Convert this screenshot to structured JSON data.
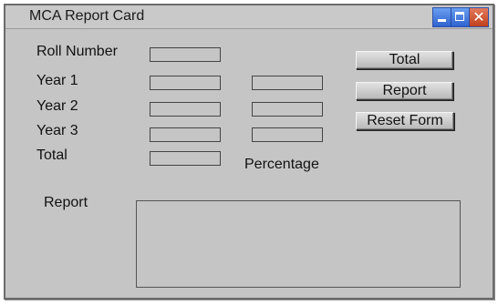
{
  "window": {
    "title": "MCA Report Card"
  },
  "controls": {
    "minimize_icon": "minimize-icon",
    "maximize_icon": "maximize-icon",
    "close_icon": "close-icon",
    "accent": "#3b6fd6",
    "close_color": "#c1401c"
  },
  "form": {
    "roll_number_label": "Roll Number",
    "year1_label": "Year 1",
    "year2_label": "Year 2",
    "year3_label": "Year 3",
    "total_label": "Total",
    "percentage_label": "Percentage",
    "report_label": "Report",
    "roll_number_value": "",
    "year1_value_a": "",
    "year1_value_b": "",
    "year2_value_a": "",
    "year2_value_b": "",
    "year3_value_a": "",
    "year3_value_b": "",
    "total_value": "",
    "report_value": ""
  },
  "buttons": {
    "total": "Total",
    "report": "Report",
    "reset": "Reset Form"
  }
}
